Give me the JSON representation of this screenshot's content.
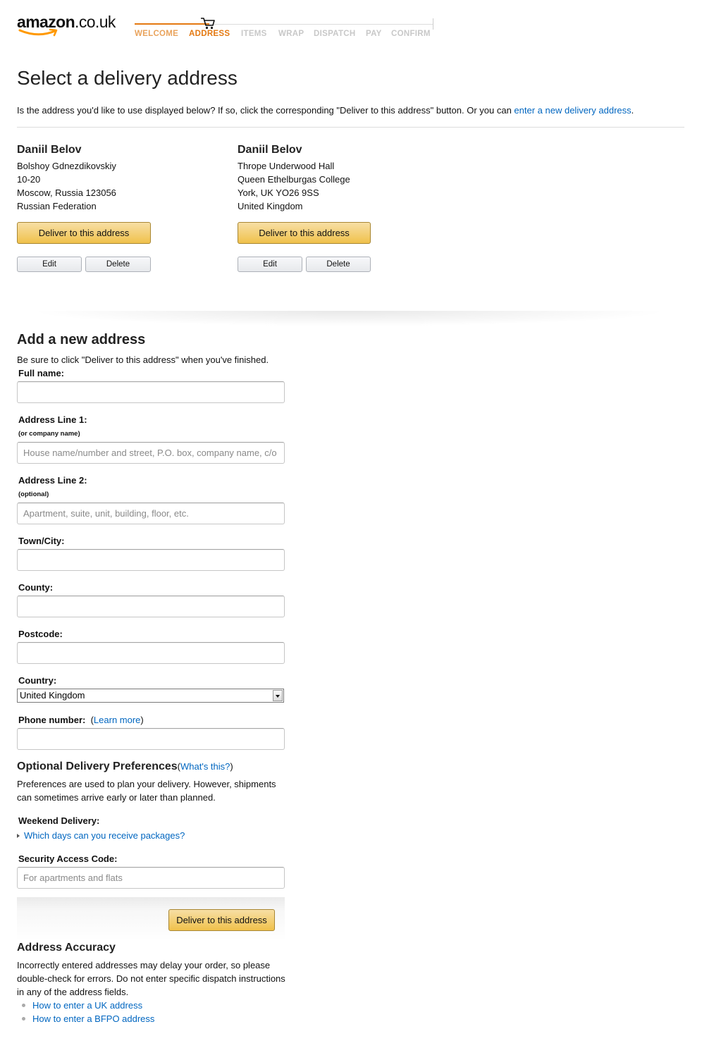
{
  "header": {
    "logo_text": "amazon",
    "logo_domain": ".co.uk",
    "steps": [
      {
        "label": "WELCOME",
        "state": "done"
      },
      {
        "label": "ADDRESS",
        "state": "active"
      },
      {
        "label": "ITEMS",
        "state": "pending"
      },
      {
        "label": "WRAP",
        "state": "pending"
      },
      {
        "label": "DISPATCH",
        "state": "pending"
      },
      {
        "label": "PAY",
        "state": "pending"
      },
      {
        "label": "CONFIRM",
        "state": "pending"
      }
    ]
  },
  "page": {
    "title": "Select a delivery address",
    "intro_text": "Is the address you'd like to use displayed below? If so, click the corresponding \"Deliver to this address\" button. Or you can ",
    "intro_link": "enter a new delivery address",
    "intro_end": "."
  },
  "addresses": [
    {
      "name": "Daniil Belov",
      "lines": [
        "Bolshoy Gdnezdikovskiy",
        "10-20",
        "Moscow, Russia 123056",
        "Russian Federation"
      ],
      "deliver_label": "Deliver to this address",
      "edit_label": "Edit",
      "delete_label": "Delete"
    },
    {
      "name": "Daniil Belov",
      "lines": [
        "Thrope Underwood Hall",
        "Queen Ethelburgas College",
        "York, UK YO26 9SS",
        "United Kingdom"
      ],
      "deliver_label": "Deliver to this address",
      "edit_label": "Edit",
      "delete_label": "Delete"
    }
  ],
  "new_address": {
    "title": "Add a new address",
    "subtitle": "Be sure to click \"Deliver to this address\" when you've finished.",
    "full_name": {
      "label": "Full name:",
      "value": "",
      "placeholder": ""
    },
    "address1": {
      "label": "Address Line 1:",
      "sublabel": "(or company name)",
      "value": "",
      "placeholder": "House name/number and street, P.O. box, company name, c/o"
    },
    "address2": {
      "label": "Address Line 2:",
      "sublabel": "(optional)",
      "value": "",
      "placeholder": "Apartment, suite, unit, building, floor, etc."
    },
    "town": {
      "label": "Town/City:",
      "value": "",
      "placeholder": ""
    },
    "county": {
      "label": "County:",
      "value": "",
      "placeholder": ""
    },
    "postcode": {
      "label": "Postcode:",
      "value": "",
      "placeholder": ""
    },
    "country": {
      "label": "Country:",
      "value": "United Kingdom"
    },
    "phone": {
      "label": "Phone number:",
      "link_open": "(",
      "link": "Learn more",
      "link_close": ")",
      "value": "",
      "placeholder": ""
    }
  },
  "preferences": {
    "title": "Optional Delivery Preferences",
    "title_link_open": "(",
    "title_link": "What's this?",
    "title_link_close": ")",
    "text_line1": "Preferences are used to plan your delivery. However, shipments",
    "text_line2": "can sometimes arrive early or later than planned.",
    "weekend_label": "Weekend Delivery:",
    "weekend_link": "Which days can you receive packages?",
    "security_label": "Security Access Code:",
    "security_placeholder": "For apartments and flats",
    "security_value": "",
    "submit_label": "Deliver to this address"
  },
  "accuracy": {
    "title": "Address Accuracy",
    "text_line1": "Incorrectly entered addresses may delay your order, so please",
    "text_line2": "double-check for errors. Do not enter specific dispatch instructions",
    "text_line3": "in any of the address fields.",
    "links": [
      "How to enter a UK address",
      "How to enter a BFPO address"
    ]
  },
  "colors": {
    "brand_orange": "#e47911",
    "link_blue": "#0066c0",
    "button_yellow": "#f0c14b",
    "step_inactive": "#c8c8c8"
  }
}
